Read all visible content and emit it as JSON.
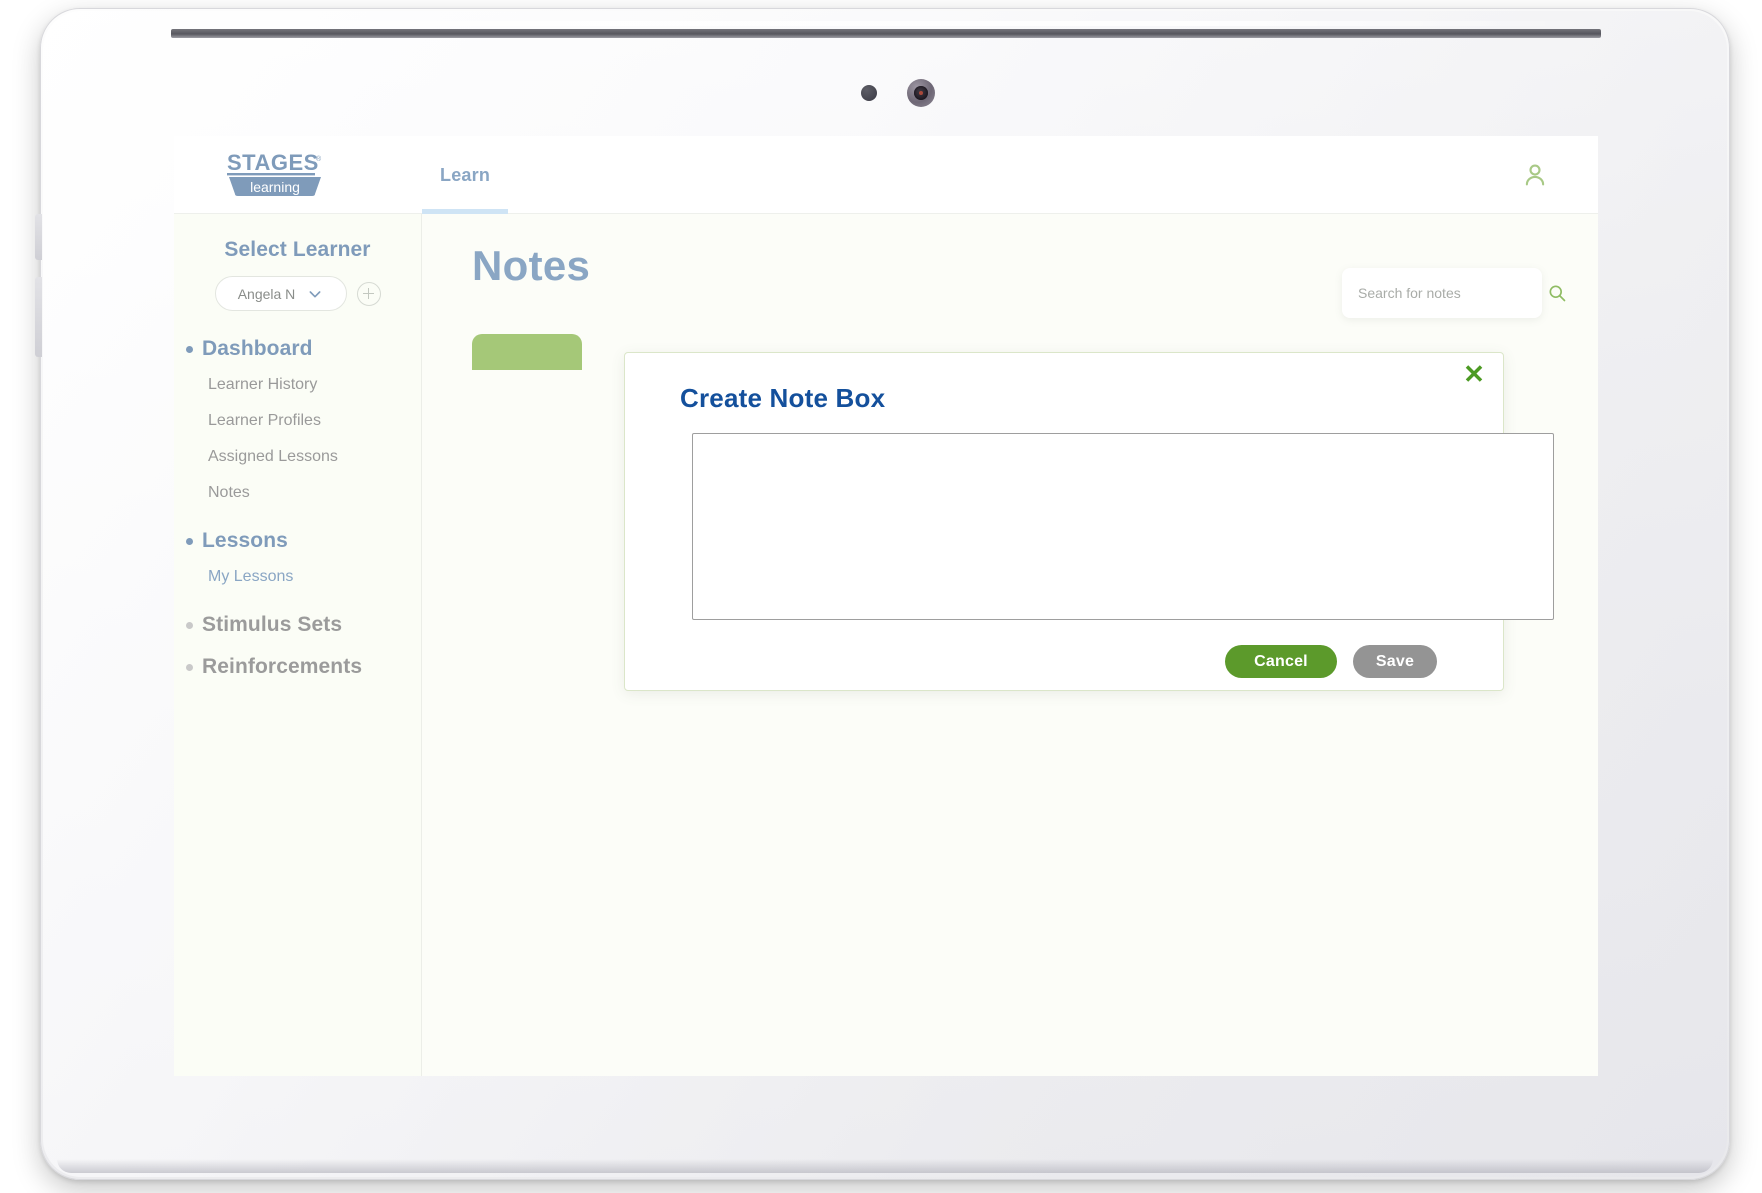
{
  "device": {
    "sensor_icon": "proximity-sensor",
    "camera_icon": "front-camera"
  },
  "header": {
    "logo_primary": "STAGES",
    "logo_registered": "®",
    "logo_secondary": "learning",
    "tabs": [
      {
        "label": "Learn",
        "active": true
      }
    ],
    "account_icon": "user-account-icon"
  },
  "sidebar": {
    "title": "Select Learner",
    "learner_select": {
      "value": "Angela N",
      "chevron_icon": "chevron-down-icon"
    },
    "add_learner_icon": "plus-circle-icon",
    "groups": [
      {
        "label": "Dashboard",
        "state": "active",
        "items": [
          {
            "label": "Learner History",
            "style": "muted"
          },
          {
            "label": "Learner Profiles",
            "style": "muted"
          },
          {
            "label": "Assigned Lessons",
            "style": "muted"
          },
          {
            "label": "Notes",
            "style": "muted"
          }
        ]
      },
      {
        "label": "Lessons",
        "state": "active",
        "items": [
          {
            "label": "My Lessons",
            "style": "link"
          }
        ]
      },
      {
        "label": "Stimulus Sets",
        "state": "muted",
        "items": []
      },
      {
        "label": "Reinforcements",
        "state": "muted",
        "items": []
      }
    ]
  },
  "main": {
    "page_title": "Notes",
    "search": {
      "placeholder": "Search for notes",
      "value": "",
      "icon": "search-icon"
    },
    "note_tab_label": ""
  },
  "modal": {
    "title": "Create Note Box",
    "close_icon": "close-icon",
    "close_label": "✕",
    "textarea": {
      "value": "",
      "placeholder": ""
    },
    "cancel_label": "Cancel",
    "save_label": "Save"
  },
  "colors": {
    "brand_blue": "#7f9bba",
    "title_blue": "#14509c",
    "accent_green": "#5c9a2b",
    "tab_green": "#a5c878",
    "save_gray": "#949494",
    "tab_underline": "#cfe4f5",
    "page_bg": "#fcfdf8"
  }
}
